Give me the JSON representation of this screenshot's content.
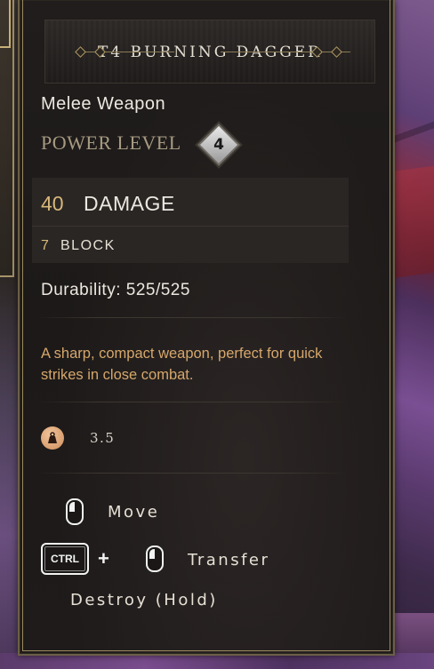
{
  "item": {
    "title": "T4 BURNING DAGGER",
    "type": "Melee Weapon",
    "power_level_label": "POWER LEVEL",
    "power_level_value": "4"
  },
  "stats": {
    "damage_value": "40",
    "damage_label": "DAMAGE",
    "block_value": "7",
    "block_label": "BLOCK",
    "durability": "Durability: 525/525"
  },
  "description": "A sharp, compact weapon, perfect for quick strikes in close combat.",
  "weight": {
    "icon": "weight-icon",
    "value": "3.5"
  },
  "actions": {
    "move_label": "Move",
    "ctrl_key": "CTRL",
    "plus": "+",
    "transfer_label": "Transfer",
    "destroy_label": "Destroy (Hold)"
  },
  "colors": {
    "accent_gold": "#d8b77a",
    "description": "#d6a76b",
    "text": "#ece8e0",
    "muted": "#a79a82"
  }
}
